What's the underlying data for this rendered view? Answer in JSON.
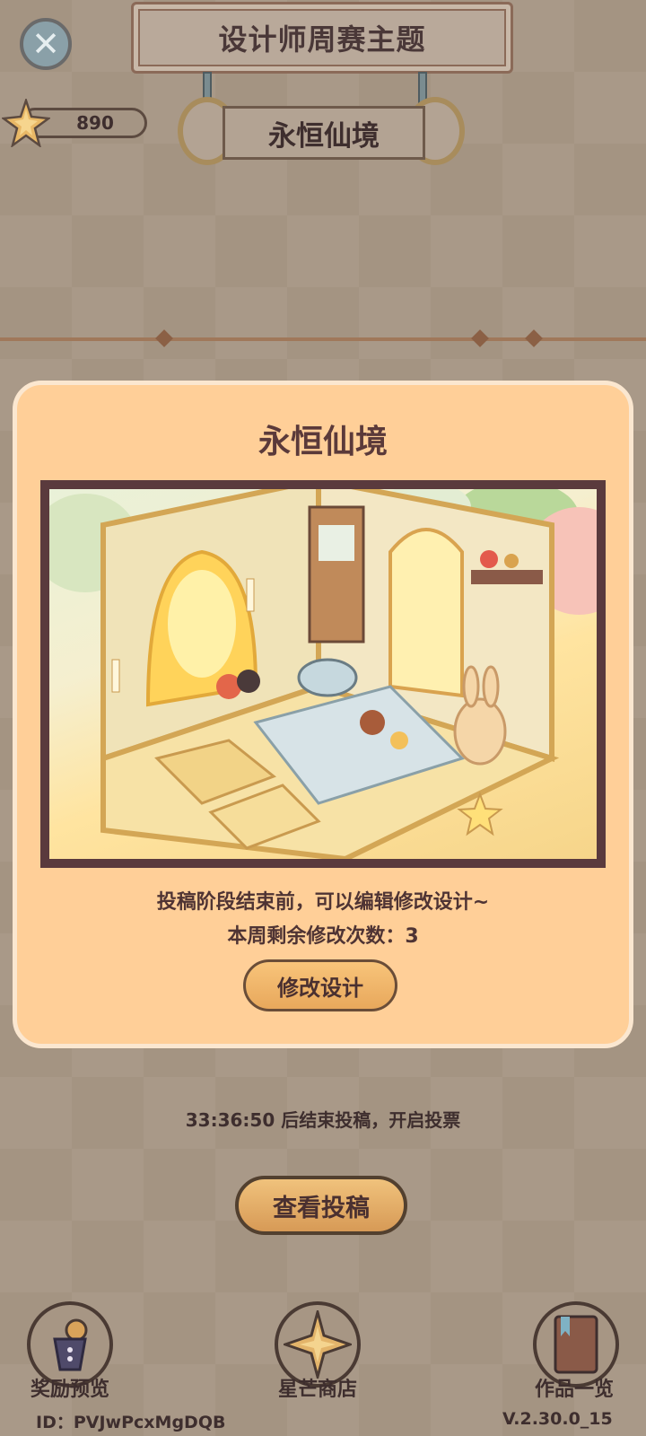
{
  "header": {
    "title": "设计师周赛主题",
    "theme": "永恒仙境",
    "star_count": "890",
    "icons": {
      "close": "close-icon",
      "star": "star-icon"
    }
  },
  "modal": {
    "title": "永恒仙境",
    "line1": "投稿阶段结束前，可以编辑修改设计~",
    "line2": "本周剩余修改次数：3",
    "edit_button": "修改设计",
    "image_name": "room-design-image"
  },
  "countdown": "33:36:50 后结束投稿，开启投票",
  "view_button": "查看投稿",
  "nav": [
    {
      "label": "奖励预览",
      "icon": "trophy-icon"
    },
    {
      "label": "星芒商店",
      "icon": "compass-star-icon"
    },
    {
      "label": "作品一览",
      "icon": "book-icon"
    }
  ],
  "footer": {
    "id_text": "ID：PVJwPcxMgDQB",
    "version": "V.2.30.0_15"
  },
  "colors": {
    "modal_bg": "#ffcf98",
    "modal_border": "#fbe7d0",
    "text_dark": "#4f3434",
    "button": "#e8a85c"
  }
}
